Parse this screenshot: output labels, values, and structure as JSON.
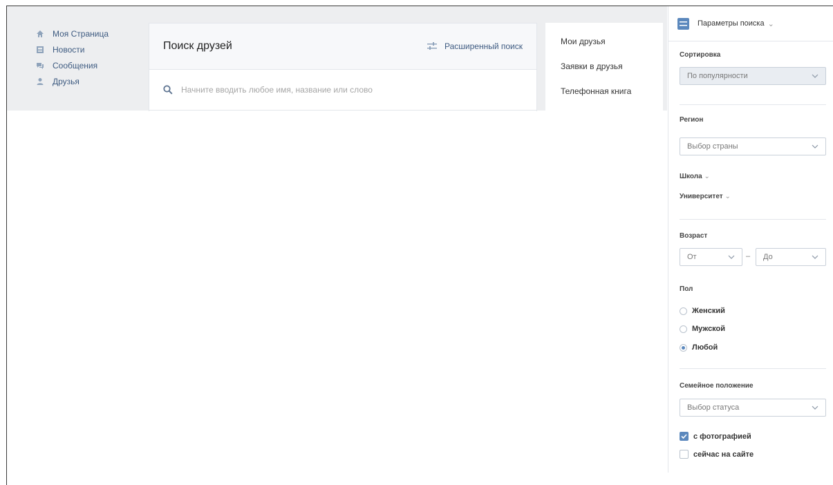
{
  "nav": {
    "items": [
      {
        "label": "Моя Страница",
        "icon": "home-icon"
      },
      {
        "label": "Новости",
        "icon": "news-icon"
      },
      {
        "label": "Сообщения",
        "icon": "messages-icon"
      },
      {
        "label": "Друзья",
        "icon": "friends-icon"
      }
    ]
  },
  "search_card": {
    "title": "Поиск друзей",
    "advanced_label": "Расширенный поиск",
    "search_placeholder": "Начните вводить любое имя, название или слово"
  },
  "friends_menu": {
    "items": [
      "Мои друзья",
      "Заявки в друзья",
      "Телефонная книга"
    ]
  },
  "panel": {
    "title": "Параметры поиска",
    "sort": {
      "label": "Сортировка",
      "value": "По популярности"
    },
    "region": {
      "label": "Регион",
      "value": "Выбор страны"
    },
    "school_label": "Школа",
    "university_label": "Университет",
    "age": {
      "label": "Возраст",
      "from": "От",
      "to": "До",
      "dash": "–"
    },
    "gender": {
      "label": "Пол",
      "options": [
        "Женский",
        "Мужской",
        "Любой"
      ],
      "selected": "Любой"
    },
    "family": {
      "label": "Семейное положение",
      "value": "Выбор статуса"
    },
    "with_photo": {
      "label": "с фотографией",
      "checked": true
    },
    "online_now": {
      "label": "сейчас на сайте",
      "checked": false
    }
  },
  "colors": {
    "accent": "#5b88bd",
    "link": "#3d5a80",
    "background": "#edeef0"
  }
}
